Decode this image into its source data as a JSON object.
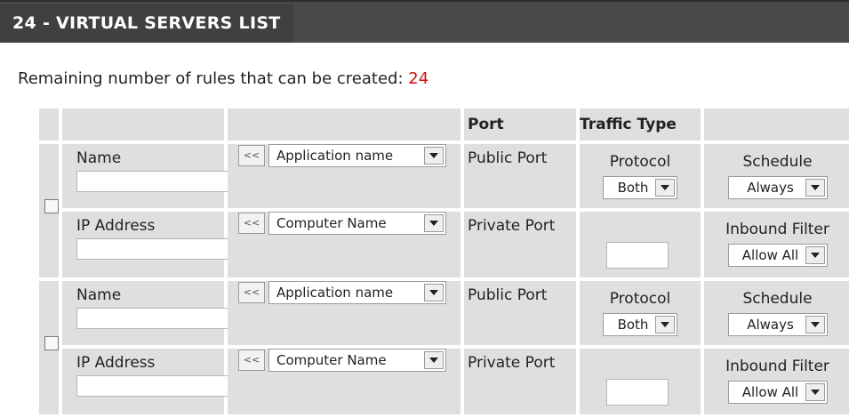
{
  "title": "24 - VIRTUAL SERVERS LIST",
  "remaining": {
    "label": "Remaining number of rules that can be created:",
    "count": "24"
  },
  "headers": {
    "port": "Port",
    "traffic_type": "Traffic Type"
  },
  "rules": [
    {
      "name_label": "Name",
      "ip_label": "IP Address",
      "arrows": "<<",
      "app_select": "Application name",
      "computer_select": "Computer Name",
      "public_port_label": "Public Port",
      "private_port_label": "Private Port",
      "protocol_label": "Protocol",
      "protocol_value": "Both",
      "schedule_label": "Schedule",
      "schedule_value": "Always",
      "inbound_label": "Inbound Filter",
      "inbound_value": "Allow All"
    },
    {
      "name_label": "Name",
      "ip_label": "IP Address",
      "arrows": "<<",
      "app_select": "Application name",
      "computer_select": "Computer Name",
      "public_port_label": "Public Port",
      "private_port_label": "Private Port",
      "protocol_label": "Protocol",
      "protocol_value": "Both",
      "schedule_label": "Schedule",
      "schedule_value": "Always",
      "inbound_label": "Inbound Filter",
      "inbound_value": "Allow All"
    }
  ]
}
